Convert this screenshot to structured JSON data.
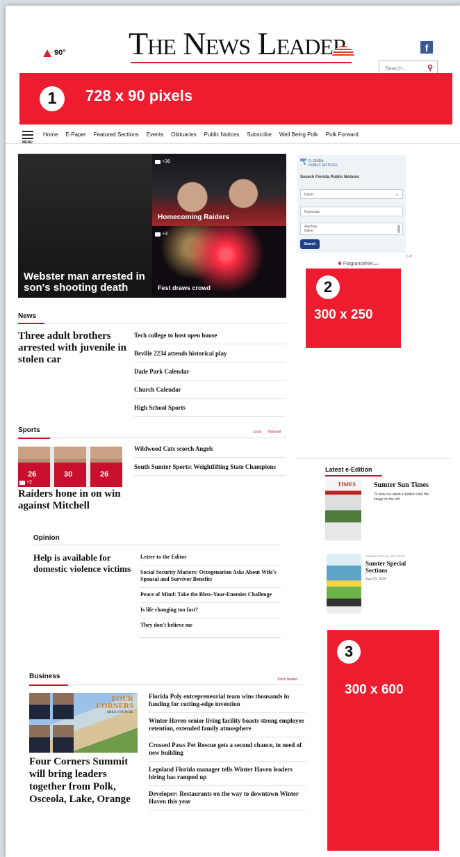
{
  "header": {
    "temp": "90°",
    "logo": "The News Leader",
    "search_placeholder": "Search..."
  },
  "ads": {
    "top": {
      "num": "1",
      "label": "728 x 90 pixels"
    },
    "side1": {
      "num": "2",
      "label": "300 x 250"
    },
    "side2": {
      "num": "3",
      "label": "300 x 600"
    }
  },
  "nav": {
    "menu_label": "MENU",
    "items": [
      "Home",
      "E-Paper",
      "Featured Sections",
      "Events",
      "Obituaries",
      "Public Notices",
      "Subscribe",
      "Well Being Polk",
      "Polk Forward"
    ]
  },
  "hero": {
    "main_title": "Webster man arrested in son's shooting death",
    "top_right": {
      "title": "Homecoming Raiders",
      "count": "+36"
    },
    "bottom_right": {
      "title": "Fest draws crowd",
      "count": "+3"
    }
  },
  "public_notices": {
    "logo_line1": "FLORIDA",
    "logo_line2": "PUBLIC NOTICES",
    "heading": "Search Florida Public Notices",
    "select_value": "Paper",
    "keywords_placeholder": "Keywords",
    "list": [
      "Alachua",
      "Baker"
    ],
    "button": "Search"
  },
  "fragrance": {
    "brand": "FragranceNet",
    "suffix": ".com"
  },
  "news": {
    "heading": "News",
    "lead": "Three adult brothers arrested with juvenile in stolen car",
    "items": [
      "Tech college to host open house",
      "Beville 2234 attends historical play",
      "Dade Park Calendar",
      "Church Calendar",
      "High School Sports"
    ]
  },
  "sports": {
    "heading": "Sports",
    "tabs": [
      "Local",
      "National"
    ],
    "lead": "Raiders hone in on win against Mitchell",
    "photo_count": "+2",
    "items": [
      "Wildwood Cats scorch Angels",
      "South Sumter Sports: Weightlifting State Champions"
    ]
  },
  "opinion": {
    "heading": "Opinion",
    "lead": "Help is available for domestic violence victims",
    "items": [
      "Letter to the Editor",
      "Social Security Matters: Octogenarian Asks About Wife's Spousal and Survivor Benefits",
      "Peace of Mind: Take the Bless-Your-Enemies Challenge",
      "Is life changing too fast?",
      "They don't believe me"
    ]
  },
  "edition": {
    "heading": "Latest e-Edition",
    "item1": {
      "title": "Sumter Sun Times",
      "desc": "To view our latest e-Edition click the image on the left.",
      "paper_label": "TIMES"
    },
    "item2": {
      "kicker": "SUMTER SPECIAL SECTIONS",
      "title": "Sumter Special Sections",
      "date": "Sep 30, 2020"
    }
  },
  "business": {
    "heading": "Business",
    "tab": "Stock Market",
    "lead": "Four Corners Summit will bring leaders together from Polk, Osceola, Lake, Orange",
    "image_logo": [
      "FOUR",
      "CORNERS",
      "AREA COUNCIL"
    ],
    "items": [
      "Florida Poly entrepreneurial team wins thousands in funding for cutting-edge invention",
      "Winter Haven senior living facility boasts strong employee retention, extended family atmosphere",
      "Crossed Paws Pet Rescue gets a second chance, in need of new building",
      "Legoland Florida manager tells Winter Haven leaders hiring has ramped up",
      "Developer: Restaurants on the way to downtown Winter Haven this year"
    ]
  }
}
